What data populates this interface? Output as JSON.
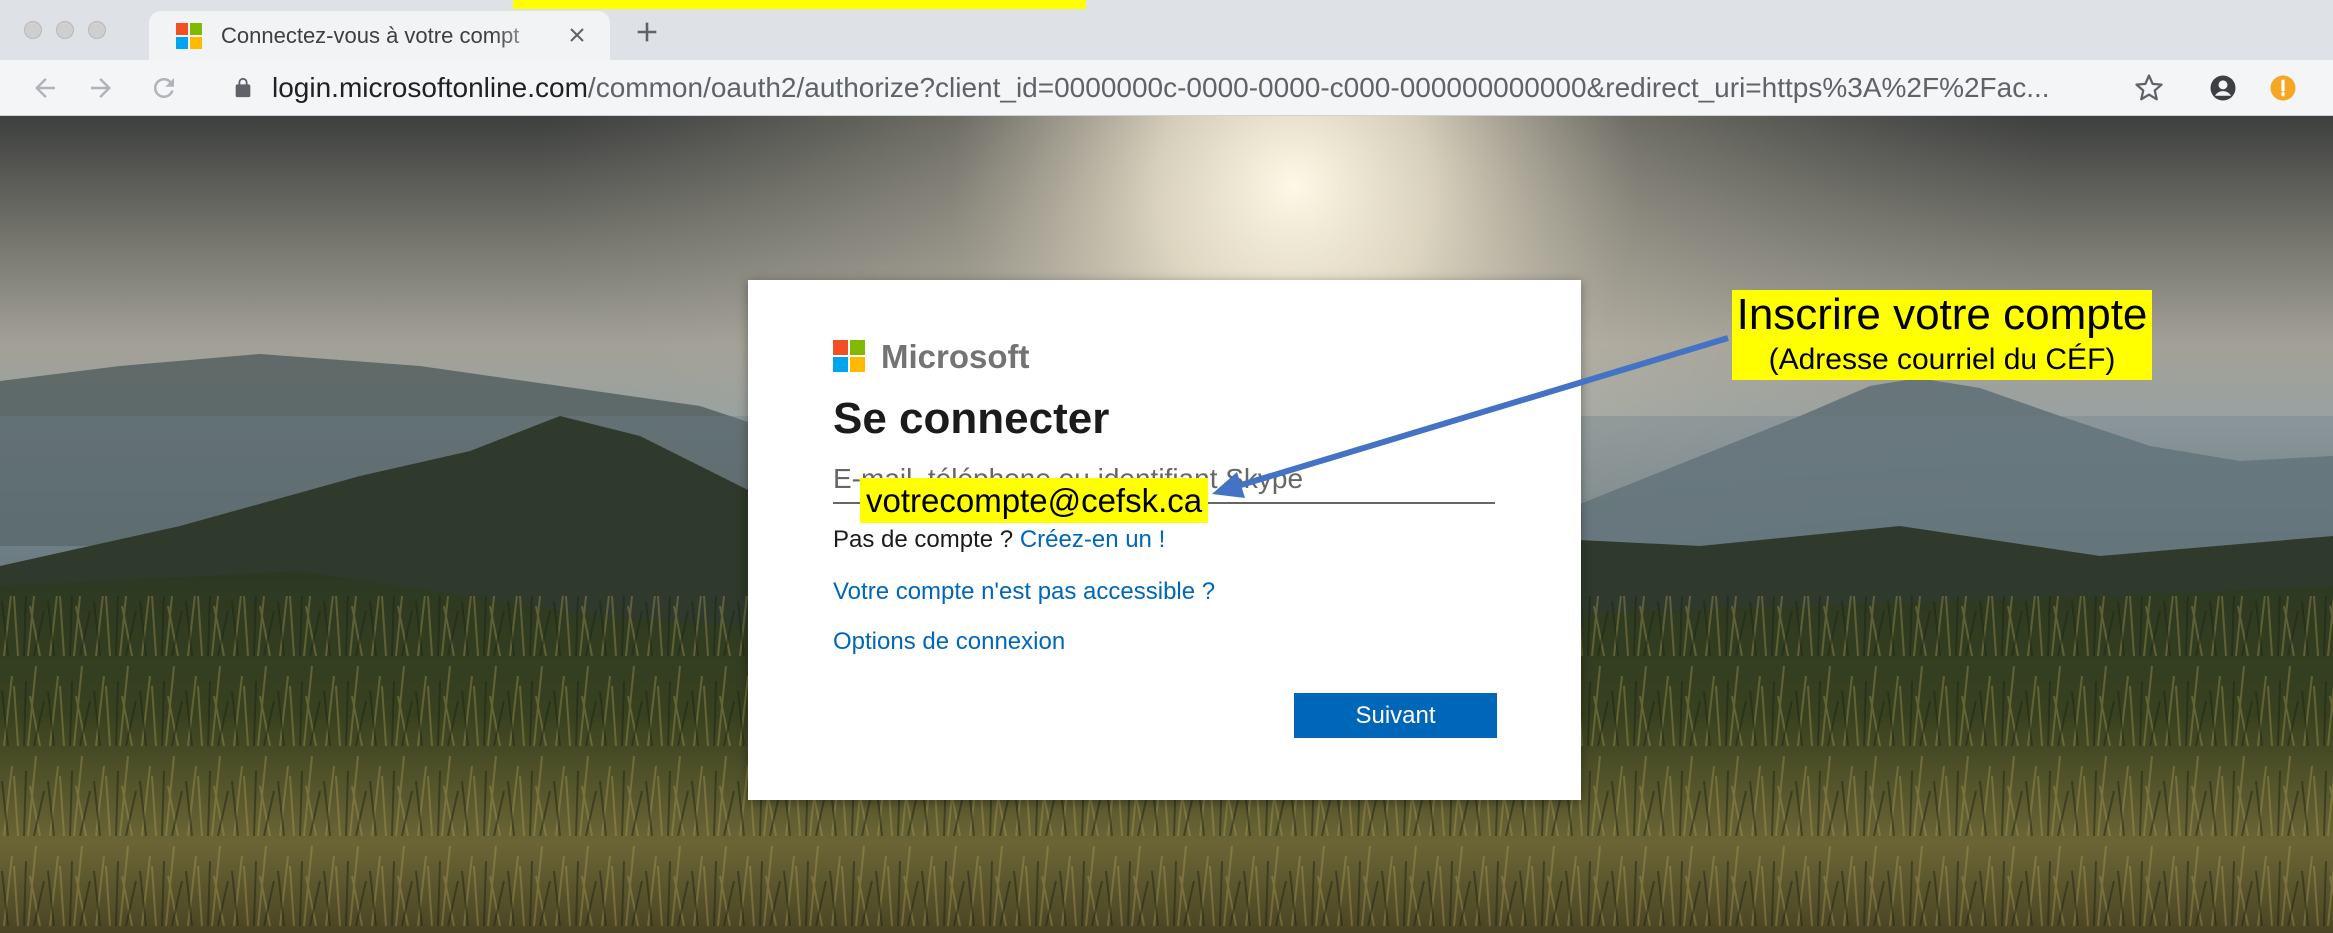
{
  "browser": {
    "tab": {
      "title": "Connectez-vous à votre compt"
    },
    "url": {
      "host": "login.microsoftonline.com",
      "path": "/common/oauth2/authorize?client_id=0000000c-0000-0000-c000-000000000000&redirect_uri=https%3A%2F%2Fac..."
    },
    "icons": {
      "window_controls": [
        "window-close-icon",
        "window-minimize-icon",
        "window-zoom-icon"
      ],
      "favicon": "microsoft-logo-icon",
      "tab_close": "close-icon",
      "new_tab": "plus-icon",
      "back": "back-arrow-icon",
      "forward": "forward-arrow-icon",
      "reload": "reload-icon",
      "secure": "lock-icon",
      "bookmark": "star-icon",
      "profile": "account-icon",
      "menu_badge": "update-icon"
    }
  },
  "login": {
    "brand": "Microsoft",
    "title": "Se connecter",
    "email_placeholder": "E-mail, téléphone ou identifiant Skype",
    "no_account_text": "Pas de compte ?",
    "create_account_link": "Créez-en un !",
    "account_inaccessible_link": "Votre compte n'est pas accessible ?",
    "signin_options_link": "Options de connexion",
    "next_button": "Suivant"
  },
  "annotations": {
    "callout_title": "Inscrire votre compte",
    "callout_subtitle": "(Adresse courriel du CÉF)",
    "email_example": "votrecompte@cefsk.ca"
  },
  "colors": {
    "link": "#0067b8",
    "button": "#0067b8",
    "highlight": "#ffff00",
    "arrow": "#4472c4",
    "logo": [
      "#f25022",
      "#7fba00",
      "#00a4ef",
      "#ffb900"
    ]
  }
}
